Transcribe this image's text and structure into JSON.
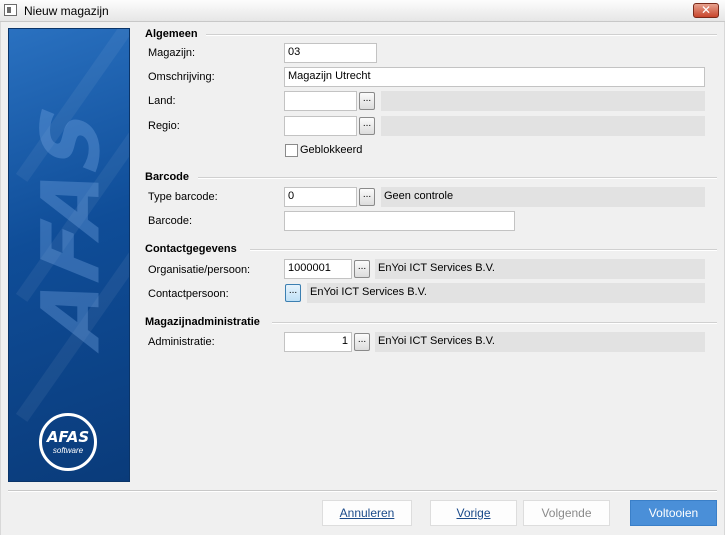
{
  "window": {
    "title": "Nieuw magazijn",
    "close_glyph": "✕"
  },
  "brand": {
    "word": "AFAS",
    "logo_text": "AFAS",
    "logo_sub": "software"
  },
  "sections": {
    "algemeen": {
      "title": "Algemeen",
      "magazijn": {
        "label": "Magazijn:",
        "value": "03"
      },
      "omschrijving": {
        "label": "Omschrijving:",
        "value": "Magazijn Utrecht"
      },
      "land": {
        "label": "Land:",
        "value": "",
        "display": ""
      },
      "regio": {
        "label": "Regio:",
        "value": "",
        "display": ""
      },
      "geblokkeerd": {
        "label": "Geblokkeerd",
        "checked": false
      }
    },
    "barcode": {
      "title": "Barcode",
      "type_barcode": {
        "label": "Type barcode:",
        "value": "0",
        "display": "Geen controle"
      },
      "barcode": {
        "label": "Barcode:",
        "value": ""
      }
    },
    "contactgegevens": {
      "title": "Contactgegevens",
      "organisatie": {
        "label": "Organisatie/persoon:",
        "value": "1000001",
        "display": "EnYoi ICT Services B.V."
      },
      "contactpersoon": {
        "label": "Contactpersoon:",
        "display": "EnYoi ICT Services B.V."
      }
    },
    "magazijnadministratie": {
      "title": "Magazijnadministratie",
      "administratie": {
        "label": "Administratie:",
        "value": "1",
        "display": "EnYoi ICT Services B.V."
      }
    }
  },
  "lookup_glyph": "...",
  "buttons": {
    "annuleren": {
      "label": "Annuleren",
      "enabled": true
    },
    "vorige": {
      "label": "Vorige",
      "enabled": true
    },
    "volgende": {
      "label": "Volgende",
      "enabled": false
    },
    "voltooien": {
      "label": "Voltooien",
      "enabled": true
    }
  },
  "colors": {
    "banner": "#0f4d98",
    "primary_button": "#4a8fd8",
    "close_button": "#c8452c"
  },
  "icons": {
    "app": "window-icon",
    "close": "close-icon",
    "logo": "afas-logo"
  }
}
